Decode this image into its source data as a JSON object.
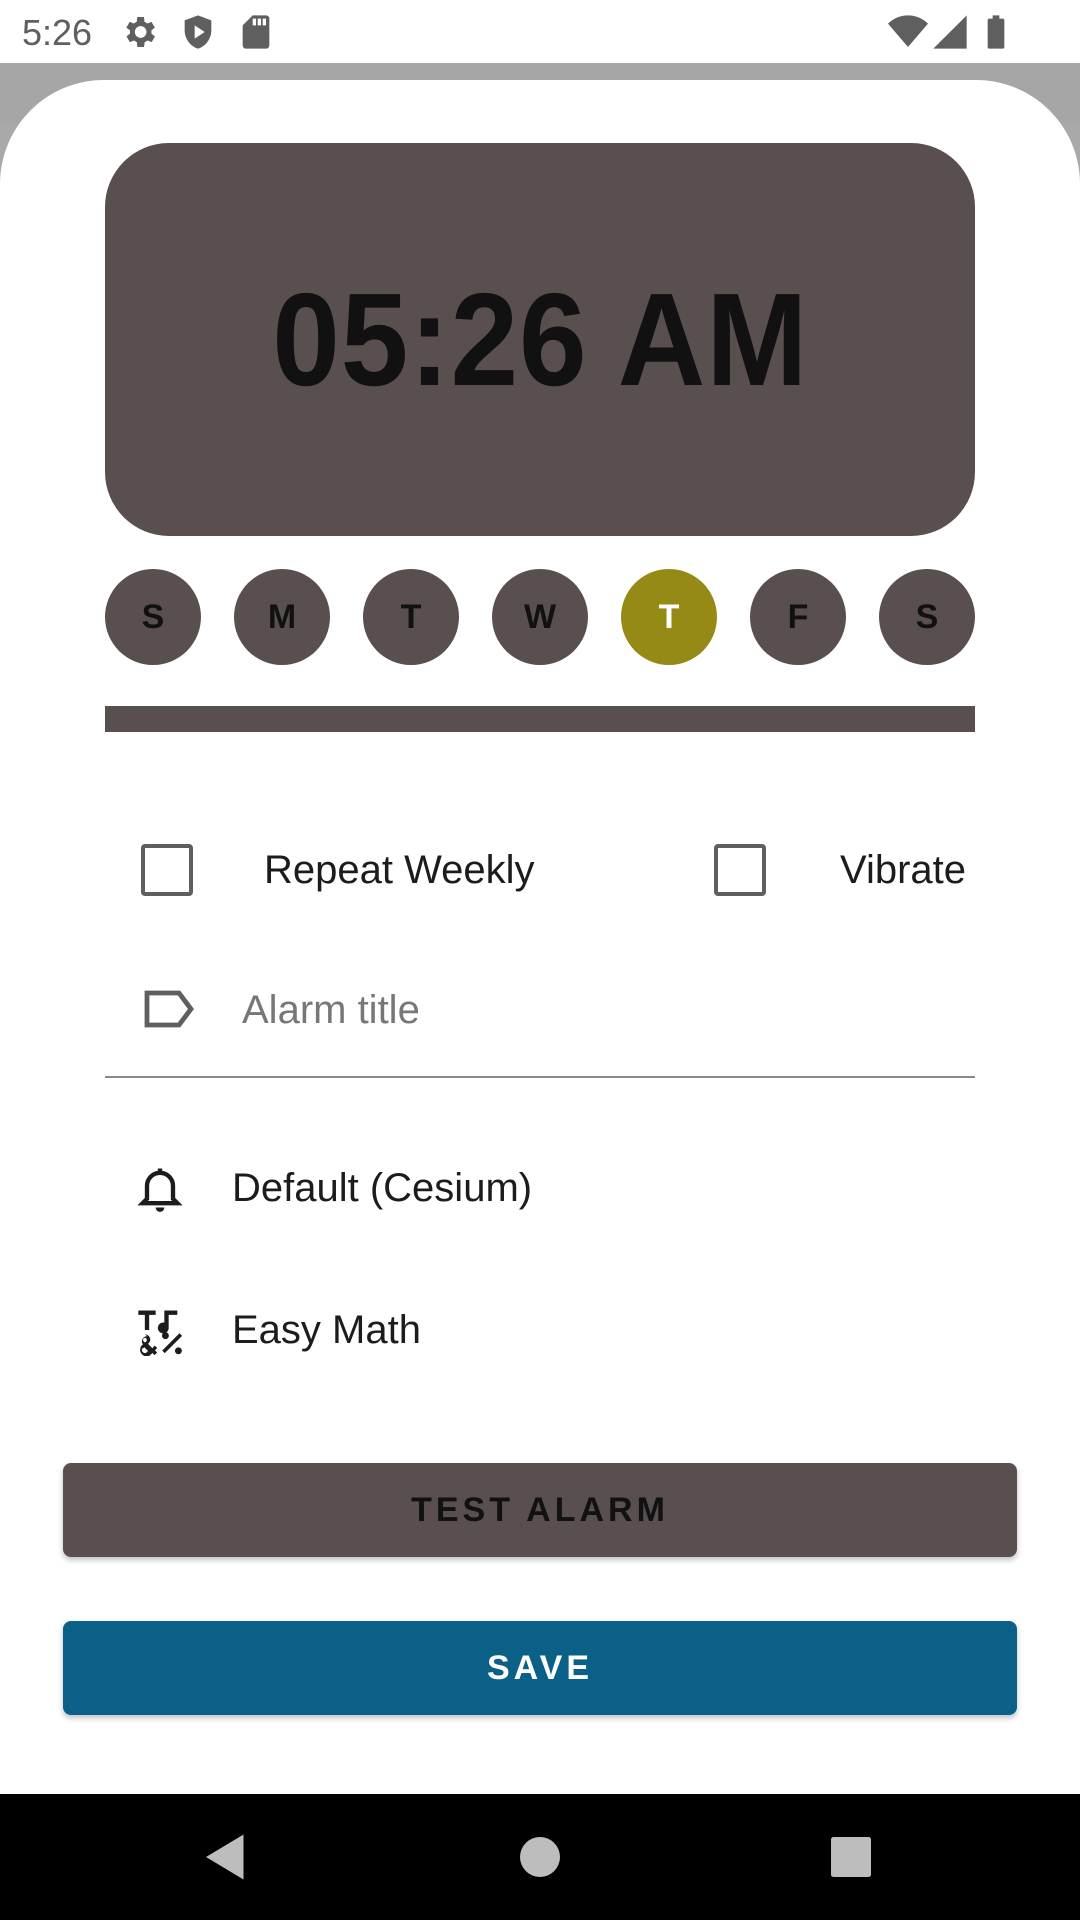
{
  "status_bar": {
    "time": "5:26",
    "left_icons": [
      "settings-icon",
      "shield-play-icon",
      "sd-card-icon"
    ],
    "right_icons": [
      "wifi-icon",
      "signal-icon",
      "battery-icon"
    ]
  },
  "alarm": {
    "time": "05:26 AM",
    "days": [
      {
        "label": "S",
        "selected": false
      },
      {
        "label": "M",
        "selected": false
      },
      {
        "label": "T",
        "selected": false
      },
      {
        "label": "W",
        "selected": false
      },
      {
        "label": "T",
        "selected": true
      },
      {
        "label": "F",
        "selected": false
      },
      {
        "label": "S",
        "selected": false
      }
    ],
    "repeat_weekly": {
      "label": "Repeat Weekly",
      "checked": false
    },
    "vibrate": {
      "label": "Vibrate",
      "checked": false
    },
    "title_field": {
      "placeholder": "Alarm title",
      "value": ""
    },
    "ringtone": {
      "label": "Default (Cesium)",
      "icon": "bell-icon"
    },
    "challenge": {
      "label": "Easy Math",
      "icon": "math-symbols-icon"
    }
  },
  "buttons": {
    "test_alarm": "TEST ALARM",
    "save": "SAVE"
  },
  "colors": {
    "card": "#5a4f4f",
    "selected_day": "#958a16",
    "save_button": "#0a6087"
  },
  "nav_bar": {
    "icons": [
      "back-icon",
      "home-icon",
      "recents-icon"
    ]
  }
}
